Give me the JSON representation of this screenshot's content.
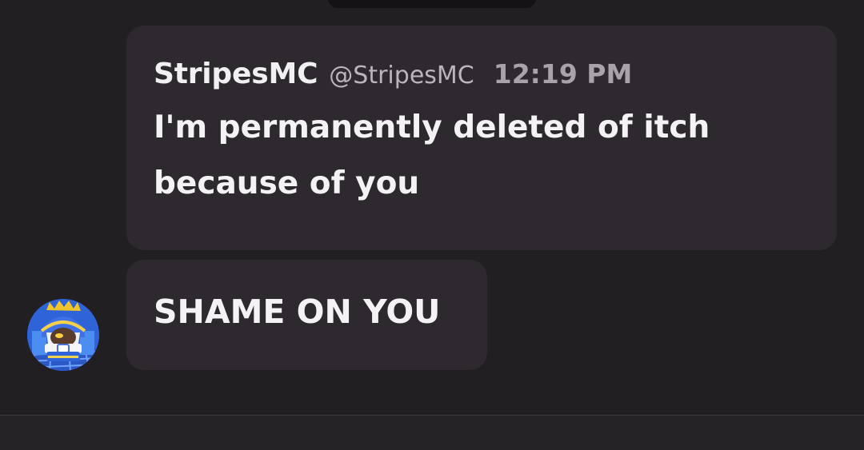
{
  "quoted_message": {
    "display_name": "StripesMC",
    "username": "@StripesMC",
    "timestamp": "12:19 PM",
    "text": "I'm permanently deleted of itch because of you"
  },
  "reply_message": {
    "text": "SHAME ON YOU"
  },
  "colors": {
    "background": "#221f22",
    "bubble": "#2d292e",
    "text": "#f4f2f4",
    "muted_text": "#b9b5ba"
  },
  "icons": {
    "avatar": "magolor-avatar-icon"
  }
}
